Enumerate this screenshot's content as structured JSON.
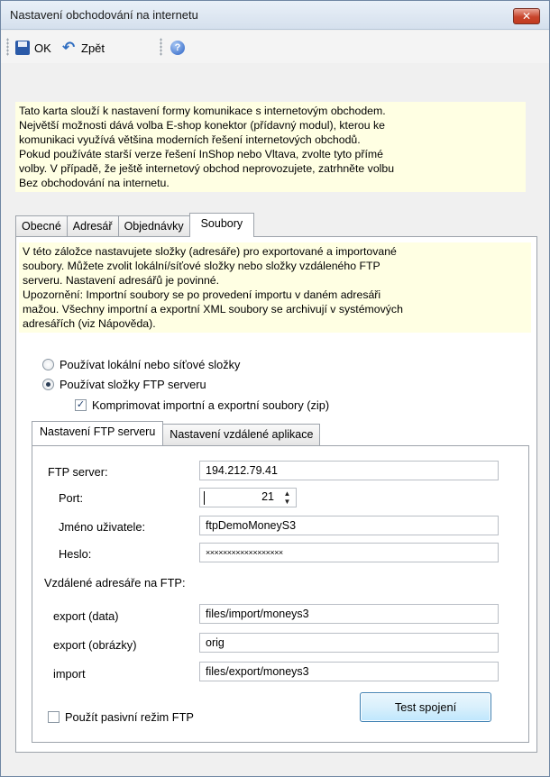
{
  "window": {
    "title": "Nastavení obchodování na internetu",
    "close_glyph": "✕"
  },
  "toolbar": {
    "ok_label": "OK",
    "back_label": "Zpět",
    "save_icon": "floppy-disk-icon",
    "back_icon": "undo-arrow-icon",
    "help_icon": "help-icon"
  },
  "intro": {
    "lines": [
      "Tato karta slouží k nastavení formy komunikace s internetovým obchodem.",
      "Největší možnosti dává volba E-shop konektor (přídavný modul), kterou ke",
      "komunikaci využívá většina moderních řešení internetových obchodů.",
      "Pokud používáte starší verze řešení InShop nebo Vltava, zvolte tyto přímé",
      "volby. V případě, že ještě internetový obchod neprovozujete, zatrhněte volbu",
      "Bez obchodování na internetu."
    ]
  },
  "main_tabs": [
    "Obecné",
    "Adresář",
    "Objednávky",
    "Soubory"
  ],
  "main_tabs_active": "Soubory",
  "files_tab": {
    "info_lines": [
      "V této záložce nastavujete složky (adresáře) pro exportované a importované",
      "soubory. Můžete zvolit lokální/síťové složky nebo složky vzdáleného FTP",
      "serveru. Nastavení adresářů je povinné.",
      "Upozornění: Importní soubory se po provedení importu v daném adresáři",
      "mažou. Všechny importní a exportní XML soubory se archivují v systémových",
      "adresářích (viz Nápověda)."
    ],
    "radio_local": "Používat lokální nebo síťové složky",
    "radio_ftp": "Používat složky FTP serveru",
    "selected": "ftp",
    "compress_label": "Komprimovat importní a exportní soubory (zip)",
    "compress_checked": true
  },
  "sub_tabs": [
    "Nastavení FTP serveru",
    "Nastavení vzdálené aplikace"
  ],
  "sub_tabs_active": "Nastavení FTP serveru",
  "ftp": {
    "server_label": "FTP server:",
    "server_value": "194.212.79.41",
    "port_label": "Port:",
    "port_value": "21",
    "user_label": "Jméno uživatele:",
    "user_value": "ftpDemoMoneyS3",
    "password_label": "Heslo:",
    "password_mask": "××××××××××××××××××",
    "remote_dirs_label": "Vzdálené adresáře na FTP:",
    "export_data_label": "export (data)",
    "export_data_value": "files/import/moneys3",
    "export_images_label": "export (obrázky)",
    "export_images_value": "orig",
    "import_label": "import",
    "import_value": "files/export/moneys3",
    "passive_label": "Použít pasivní režim FTP",
    "passive_checked": false,
    "test_button": "Test spojení"
  }
}
